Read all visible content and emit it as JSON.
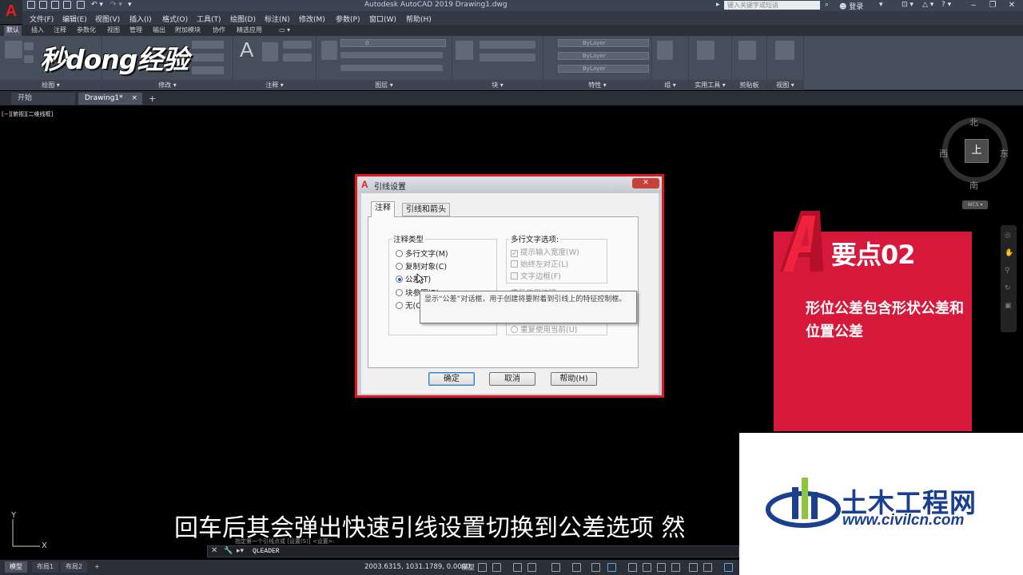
{
  "window": {
    "title": "Autodesk AutoCAD 2019    Drawing1.dwg",
    "search_placeholder": "键入关键字或短语",
    "login_label": "登录"
  },
  "menus": [
    "文件(F)",
    "编辑(E)",
    "视图(V)",
    "插入(I)",
    "格式(O)",
    "工具(T)",
    "绘图(D)",
    "标注(N)",
    "修改(M)",
    "参数(P)",
    "窗口(W)",
    "帮助(H)"
  ],
  "ribbon": {
    "tabs": [
      "默认",
      "插入",
      "注释",
      "参数化",
      "视图",
      "管理",
      "输出",
      "附加模块",
      "协作",
      "精选应用"
    ],
    "panels": [
      "绘图 ▾",
      "修改 ▾",
      "注释 ▾",
      "图层 ▾",
      "块 ▾",
      "特性 ▾",
      "组 ▾",
      "实用工具 ▾",
      "剪贴板",
      "视图 ▾"
    ],
    "bylayer": "ByLayer",
    "layer_value": "0"
  },
  "brand_logo": "秒dong经验",
  "file_tabs": {
    "start": "开始",
    "drawing": "Drawing1*",
    "close": "×",
    "add": "+"
  },
  "viewport_label": "[−][俯视][二维线框]",
  "viewcube": {
    "north": "北",
    "south": "南",
    "east": "东",
    "west": "西",
    "face": "上",
    "wcs": "WCS ▾"
  },
  "dialog": {
    "title": "引线设置",
    "close": "✕",
    "tabs": [
      "注释",
      "引线和箭头"
    ],
    "annotation_type": {
      "title": "注释类型",
      "options": [
        {
          "label": "多行文字(M)",
          "selected": false
        },
        {
          "label": "复制对象(C)",
          "selected": false
        },
        {
          "label": "公差(T)",
          "selected": true
        },
        {
          "label": "块参照(B)",
          "selected": false
        },
        {
          "label": "无(O)",
          "selected": false
        }
      ]
    },
    "mtext_options": {
      "title": "多行文字选项:",
      "items": [
        {
          "label": "提示输入宽度(W)",
          "checked": true
        },
        {
          "label": "始终左对正(L)",
          "checked": false
        },
        {
          "label": "文字边框(F)",
          "checked": false
        }
      ]
    },
    "reuse": {
      "title": "重复使用注释",
      "options": [
        "重复使用当前(U)"
      ]
    },
    "tooltip": "显示“公差”对话框，用于创建将要附着到引线上的特征控制框。",
    "buttons": {
      "ok": "确定",
      "cancel": "取消",
      "help": "帮助(H)"
    }
  },
  "card": {
    "title": "要点02",
    "body": "形位公差包含形状公差和位置公差"
  },
  "watermark": {
    "name": "土木工程网",
    "url": "www.civilcn.com"
  },
  "subtitle": "回车后其会弹出快速引线设置切换到公差选项 然",
  "command": {
    "history": "指定第一个引线点或 [设置(S)] <设置>:",
    "input": "QLEADER",
    "close": "✕"
  },
  "ucs": {
    "x": "X",
    "y": "Y"
  },
  "status": {
    "layout_tabs": [
      "模型",
      "布局1",
      "布局2"
    ],
    "add": "+",
    "coords": "2003.6315, 1031.1789, 0.0000",
    "model": "模型"
  },
  "colors": {
    "highlight_red": "#e2161d",
    "card_red": "#d6183a",
    "watermark_blue": "#1b3f8f"
  }
}
